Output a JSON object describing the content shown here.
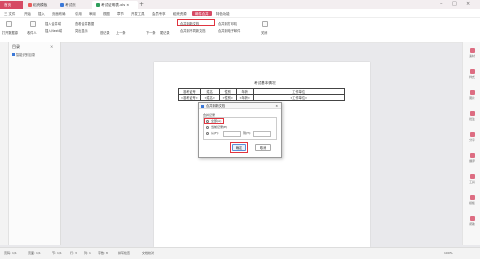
{
  "tabs": {
    "home": "首页",
    "t1": "稻壳模板",
    "t2": "考试页面.docx",
    "t3": "考试证明表.xls"
  },
  "menu": [
    "三 文件",
    "开始",
    "插入",
    "页面布局",
    "引用",
    "审阅",
    "视图",
    "章节",
    "开发工具",
    "会员专享",
    "稻壳资源",
    "邮件合并",
    "特色功能"
  ],
  "ribbon": {
    "open_source": "打开数据源",
    "recipients": "收件人",
    "insert_merge_field": "插入合并域",
    "insert_next": "插入Next域",
    "merge_to_new": "合并到新文档",
    "merge_to_printer": "合并到打印机",
    "merge_to_different": "合并到不同新文档",
    "merge_to_email": "合并到电子邮件",
    "view_merged": "查看合并数据",
    "highlight": "突出显示",
    "first": "首记录",
    "prev": "上一条",
    "next": "下一条",
    "last": "尾记录",
    "close": "关闭"
  },
  "sidebar": {
    "title": "目录",
    "item": "智能识别目录"
  },
  "document": {
    "title": "考试基本情况",
    "headers": [
      "准考证号",
      "姓名",
      "性别",
      "年龄",
      "工作单位"
    ],
    "fields": [
      "«准考证号»",
      "«姓名»",
      "«性别»",
      "«年龄»",
      "«工作单位»"
    ]
  },
  "dialog": {
    "title": "合并到新文档",
    "group": "合并记录",
    "opt_all": "全部(A)",
    "opt_current": "当前记录(E)",
    "opt_from": "从(F):",
    "to": "到(T):",
    "ok": "确定",
    "cancel": "取消"
  },
  "right_rail": [
    "素材",
    "样式",
    "图片",
    "批注",
    "分享",
    "翻译",
    "工具",
    "模板",
    "帮助"
  ],
  "status": {
    "page": "页码: 1/1",
    "pages": "页面: 1/1",
    "section": "节: 1/1",
    "row": "行: 3",
    "col": "列: 1",
    "chars": "字数: 8",
    "spell": "拼写检查",
    "compat": "文档校对",
    "zoom": "100%"
  },
  "colors": {
    "accent": "#d64a64",
    "highlight": "#e0343f"
  }
}
